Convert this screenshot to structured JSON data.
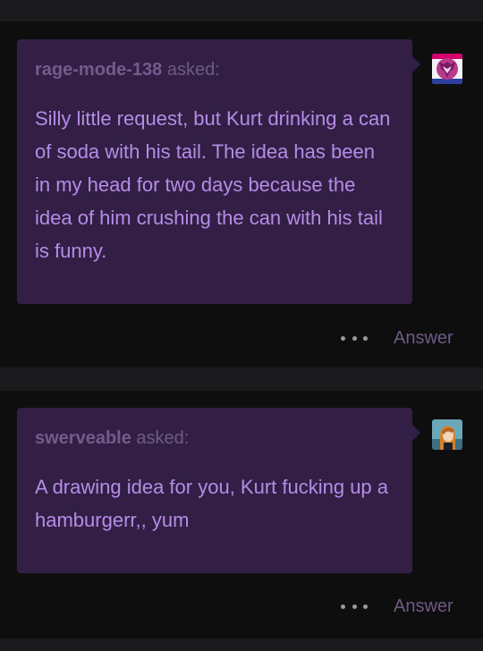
{
  "posts": [
    {
      "asker": "rage-mode-138",
      "asked_label": "asked:",
      "question": "Silly little request, but Kurt drinking a can of soda with his tail. The idea has been in my head for two days because the idea of him crushing the can with his tail is funny.",
      "avatar_icon": "decepticon-insignia-icon",
      "more_icon": "more-options-icon",
      "answer_label": "Answer"
    },
    {
      "asker": "swerveable",
      "asked_label": "asked:",
      "question": "A drawing idea for you, Kurt fucking up a hamburgerr,, yum",
      "avatar_icon": "character-portrait-icon",
      "more_icon": "more-options-icon",
      "answer_label": "Answer"
    }
  ],
  "colors": {
    "background": "#0e0e0f",
    "separator": "#1a1a1c",
    "bubble": "#331f45",
    "question_text": "#b58ce6",
    "meta_text": "#6f5a86",
    "dots": "#9a9aa0"
  }
}
